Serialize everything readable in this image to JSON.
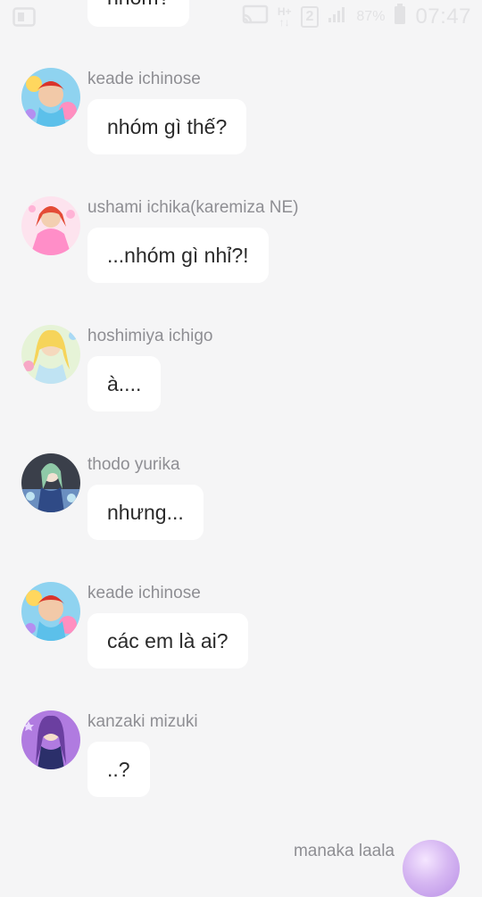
{
  "status_bar": {
    "network_label": "H+",
    "sim_label": "2",
    "battery_percent": "87%",
    "time": "07:47"
  },
  "chat": {
    "top_partial_message": "nhóm?",
    "messages": [
      {
        "sender": "keade ichinose",
        "text": "nhóm gì thế?"
      },
      {
        "sender": "ushami ichika(karemiza NE)",
        "text": "...nhóm gì nhỉ?!"
      },
      {
        "sender": "hoshimiya ichigo",
        "text": "à...."
      },
      {
        "sender": "thodo yurika",
        "text": "nhưng..."
      },
      {
        "sender": "keade ichinose",
        "text": "các em là ai?"
      },
      {
        "sender": "kanzaki mizuki",
        "text": "..?"
      }
    ],
    "bottom_partial_sender": "manaka laala"
  },
  "colors": {
    "background": "#f5f5f6",
    "bubble": "#ffffff",
    "sender_text": "#8e8e93",
    "message_text": "#2a2a2a",
    "status_icons": "#e2e2e4"
  }
}
